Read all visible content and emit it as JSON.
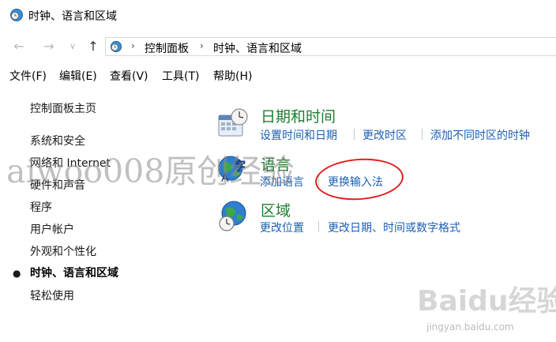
{
  "window": {
    "title": "时钟、语言和区域"
  },
  "nav": {
    "back": "←",
    "forward": "→",
    "dropdown": "∨",
    "up": "↑",
    "breadcrumb": [
      "控制面板",
      "时钟、语言和区域"
    ],
    "separator": "›"
  },
  "menu": [
    "文件(F)",
    "编辑(E)",
    "查看(V)",
    "工具(T)",
    "帮助(H)"
  ],
  "sidebar": {
    "home": "控制面板主页",
    "items": [
      "系统和安全",
      "网络和 Internet",
      "硬件和声音",
      "程序",
      "用户帐户",
      "外观和个性化",
      "时钟、语言和区域",
      "轻松使用"
    ],
    "active_index": 6,
    "bullet": "●"
  },
  "categories": [
    {
      "title": "日期和时间",
      "links": [
        "设置时间和日期",
        "更改时区",
        "添加不同时区的时钟"
      ]
    },
    {
      "title": "语言",
      "links": [
        "添加语言",
        "更换输入法"
      ]
    },
    {
      "title": "区域",
      "links": [
        "更改位置",
        "更改日期、时间或数字格式"
      ]
    }
  ],
  "watermark": {
    "text": "aiwoo008原创经验"
  },
  "baidu": {
    "logo": "Baidu经验",
    "sub": "jingyan.baidu.com"
  },
  "colors": {
    "category_title": "#1e7d32",
    "link": "#1a5fb4",
    "annotation": "#e02020"
  }
}
